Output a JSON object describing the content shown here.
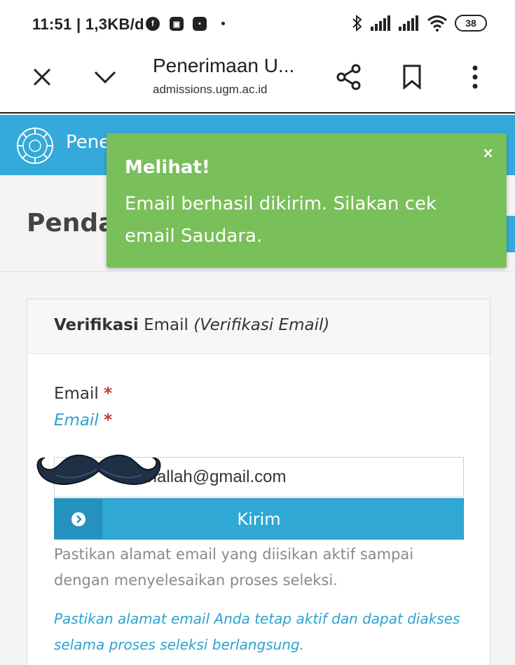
{
  "status_bar": {
    "time": "11:51 | 1,3KB/d",
    "notifications": [
      "facebook-icon",
      "app-icon",
      "app-icon"
    ],
    "battery": "38"
  },
  "browser": {
    "title": "Penerimaan U...",
    "url": "admissions.ugm.ac.id"
  },
  "site": {
    "name": "Pene"
  },
  "page": {
    "title": "Penda"
  },
  "toast": {
    "title": "Melihat!",
    "message": "Email berhasil dikirim. Silakan cek email Saudara.",
    "close": "×"
  },
  "panel": {
    "heading_bold": "Verifikasi",
    "heading_rest": " Email ",
    "heading_italic": "(Verifikasi Email)",
    "field_label": "Email",
    "field_label_alt": "Email",
    "required_mark": "*",
    "email_value": "thallah@gmail.com",
    "submit_label": "Kirim",
    "help_text": "Pastikan alamat email yang diisikan aktif sampai dengan menyelesaikan proses seleksi.",
    "help_text_alt": "Pastikan alamat email Anda tetap aktif dan dapat diakses selama proses seleksi berlangsung."
  },
  "colors": {
    "header_blue": "#35a9da",
    "toast_green": "#79bf5a",
    "accent_blue": "#2ca3cf",
    "required_red": "#c0392b"
  }
}
